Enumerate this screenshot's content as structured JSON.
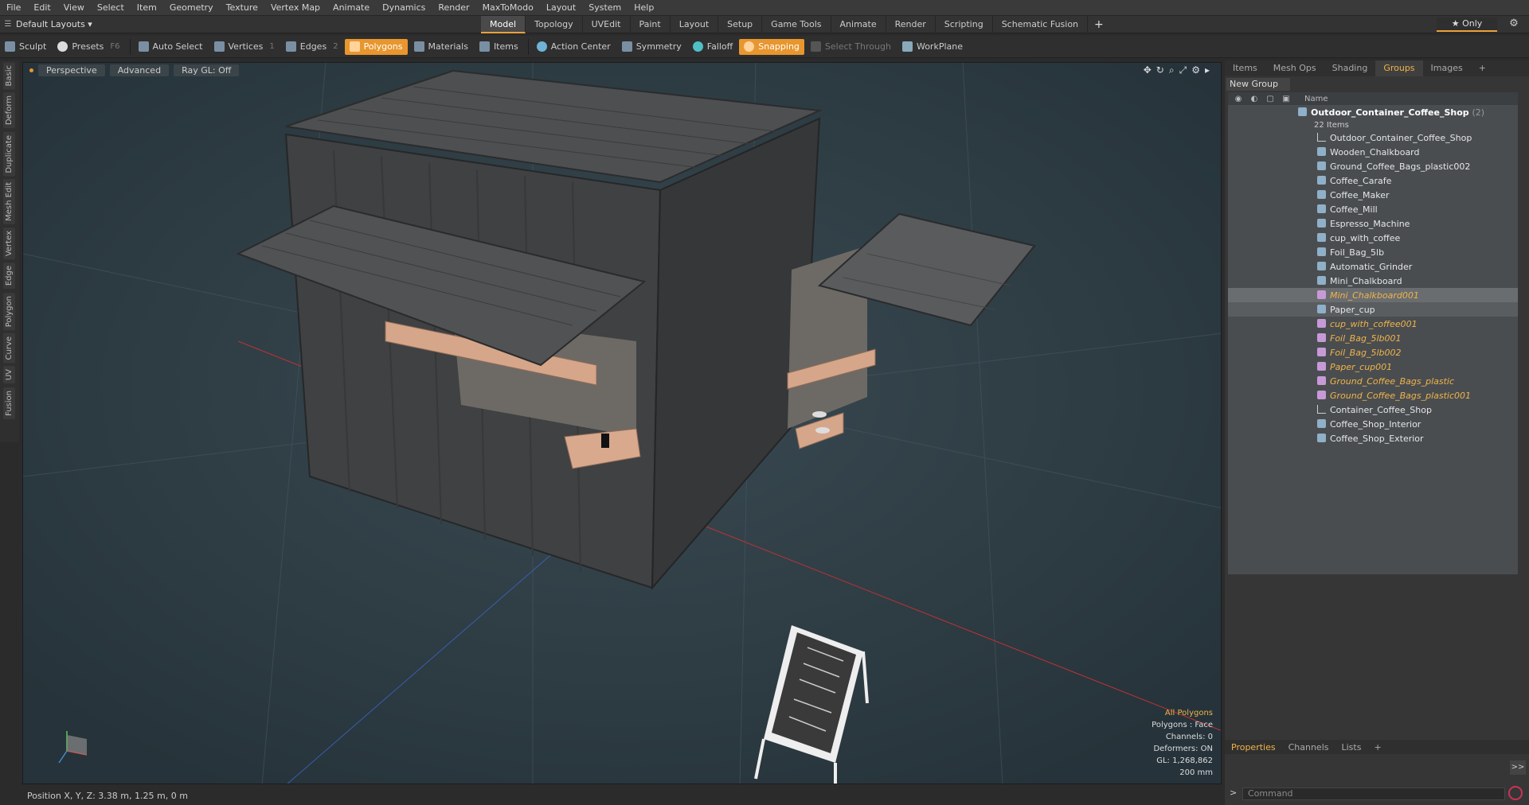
{
  "menu": [
    "File",
    "Edit",
    "View",
    "Select",
    "Item",
    "Geometry",
    "Texture",
    "Vertex Map",
    "Animate",
    "Dynamics",
    "Render",
    "MaxToModo",
    "Layout",
    "System",
    "Help"
  ],
  "layout_selector": "Default Layouts ▾",
  "workspace_tabs": [
    "Model",
    "Topology",
    "UVEdit",
    "Paint",
    "Layout",
    "Setup",
    "Game Tools",
    "Animate",
    "Render",
    "Scripting",
    "Schematic Fusion"
  ],
  "active_tab": "Model",
  "only_label": "★  Only",
  "toolbar": {
    "sculpt": "Sculpt",
    "presets": "Presets",
    "presets_key": "F6",
    "auto_select": "Auto Select",
    "vertices": "Vertices",
    "vertices_key": "1",
    "edges": "Edges",
    "edges_key": "2",
    "polygons": "Polygons",
    "materials": "Materials",
    "items": "Items",
    "action_center": "Action Center",
    "symmetry": "Symmetry",
    "falloff": "Falloff",
    "snapping": "Snapping",
    "select_through": "Select Through",
    "workplane": "WorkPlane"
  },
  "left_tabs": [
    "Basic",
    "Deform",
    "Duplicate",
    "Mesh Edit",
    "Vertex",
    "Edge",
    "Polygon",
    "Curve",
    "UV",
    "Fusion"
  ],
  "viewport": {
    "view": "Perspective",
    "mode": "Advanced",
    "raygl": "Ray GL: Off",
    "info": {
      "selection": "All Polygons",
      "polygons": "Polygons : Face",
      "channels": "Channels: 0",
      "deformers": "Deformers: ON",
      "gl": "GL: 1,268,862",
      "scale": "200 mm"
    }
  },
  "status": "Position X, Y, Z:   3.38 m, 1.25 m, 0 m",
  "right_panel": {
    "tabs": [
      "Items",
      "Mesh Ops",
      "Shading",
      "Groups",
      "Images",
      "+"
    ],
    "active_tab": "Groups",
    "new_group": "New Group",
    "name_col": "Name",
    "group_name": "Outdoor_Container_Coffee_Shop",
    "group_suffix": "(2)",
    "group_count": "22 Items",
    "items": [
      {
        "name": "Outdoor_Container_Coffee_Shop",
        "kind": "loc",
        "state": ""
      },
      {
        "name": "Wooden_Chalkboard",
        "kind": "mesh",
        "state": ""
      },
      {
        "name": "Ground_Coffee_Bags_plastic002",
        "kind": "mesh",
        "state": ""
      },
      {
        "name": "Coffee_Carafe",
        "kind": "mesh",
        "state": ""
      },
      {
        "name": "Coffee_Maker",
        "kind": "mesh",
        "state": ""
      },
      {
        "name": "Coffee_Mill",
        "kind": "mesh",
        "state": ""
      },
      {
        "name": "Espresso_Machine",
        "kind": "mesh",
        "state": ""
      },
      {
        "name": "cup_with_coffee",
        "kind": "mesh",
        "state": ""
      },
      {
        "name": "Foil_Bag_5lb",
        "kind": "mesh",
        "state": ""
      },
      {
        "name": "Automatic_Grinder",
        "kind": "mesh",
        "state": ""
      },
      {
        "name": "Mini_Chalkboard",
        "kind": "mesh",
        "state": ""
      },
      {
        "name": "Mini_Chalkboard001",
        "kind": "purple",
        "state": "sel"
      },
      {
        "name": "Paper_cup",
        "kind": "mesh",
        "state": "sel2"
      },
      {
        "name": "cup_with_coffee001",
        "kind": "purple",
        "state": "ital"
      },
      {
        "name": "Foil_Bag_5lb001",
        "kind": "purple",
        "state": "ital"
      },
      {
        "name": "Foil_Bag_5lb002",
        "kind": "purple",
        "state": "ital"
      },
      {
        "name": "Paper_cup001",
        "kind": "purple",
        "state": "ital"
      },
      {
        "name": "Ground_Coffee_Bags_plastic",
        "kind": "purple",
        "state": "ital"
      },
      {
        "name": "Ground_Coffee_Bags_plastic001",
        "kind": "purple",
        "state": "ital"
      },
      {
        "name": "Container_Coffee_Shop",
        "kind": "loc",
        "state": ""
      },
      {
        "name": "Coffee_Shop_Interior",
        "kind": "mesh",
        "state": ""
      },
      {
        "name": "Coffee_Shop_Exterior",
        "kind": "mesh",
        "state": ""
      }
    ],
    "bottom_tabs": [
      "Properties",
      "Channels",
      "Lists",
      "+"
    ],
    "bottom_active": "Properties",
    "command_placeholder": "Command",
    "expand": ">>"
  },
  "colors": {
    "accent": "#e8962e",
    "viewport_bg": "#2e3b42",
    "highlight": "#f0b44a"
  }
}
